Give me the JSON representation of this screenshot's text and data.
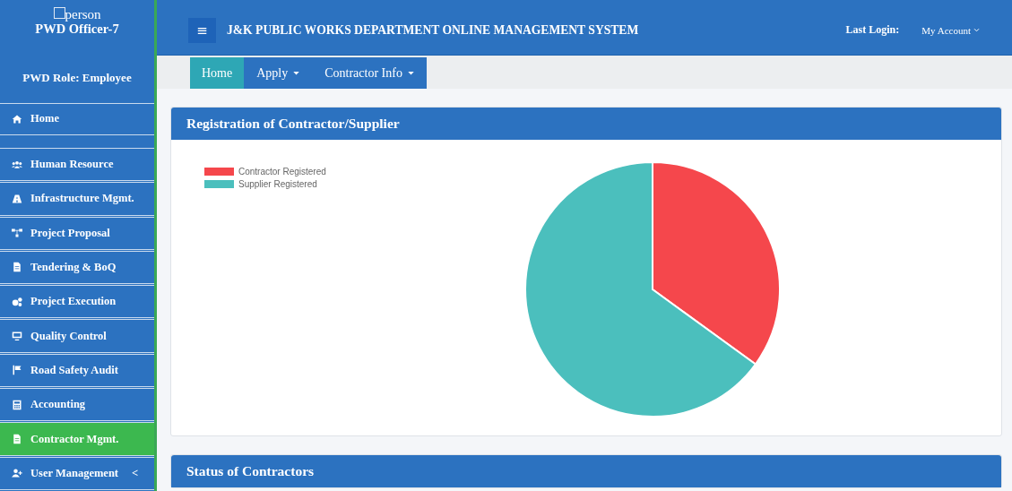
{
  "sidebar": {
    "user": {
      "icon_text": "person",
      "name": "PWD Officer-7"
    },
    "role": "PWD Role: Employee",
    "items": [
      {
        "label": "Home",
        "selected": false,
        "kind": "top"
      },
      {
        "label": "Human Resource",
        "selected": false,
        "kind": "item"
      },
      {
        "label": "Infrastructure Mgmt.",
        "selected": false,
        "kind": "item"
      },
      {
        "label": "Project Proposal",
        "selected": false,
        "kind": "item"
      },
      {
        "label": "Tendering & BoQ",
        "selected": false,
        "kind": "item"
      },
      {
        "label": "Project Execution",
        "selected": false,
        "kind": "item"
      },
      {
        "label": "Quality Control",
        "selected": false,
        "kind": "item"
      },
      {
        "label": "Road Safety Audit",
        "selected": false,
        "kind": "item"
      },
      {
        "label": "Accounting",
        "selected": false,
        "kind": "item"
      },
      {
        "label": "Contractor Mgmt.",
        "selected": true,
        "kind": "item"
      },
      {
        "label": "User Management",
        "selected": false,
        "kind": "item",
        "caret": "<"
      }
    ]
  },
  "header": {
    "menu_button": "≡",
    "title": "J&K PUBLIC WORKS DEPARTMENT ONLINE MANAGEMENT SYSTEM",
    "last_login": "Last Login:",
    "account": "My Account"
  },
  "tabs": [
    {
      "label": "Home",
      "selected": true,
      "dropdown": false
    },
    {
      "label": "Apply",
      "selected": false,
      "dropdown": true
    },
    {
      "label": "Contractor Info",
      "selected": false,
      "dropdown": true
    }
  ],
  "cards": [
    {
      "title": "Registration of Contractor/Supplier",
      "chart_data": {
        "type": "pie",
        "legend": "top-left",
        "categories": [
          "Contractor Registered",
          "Supplier Registered"
        ],
        "values": [
          35,
          65
        ],
        "colors": [
          "#f5474c",
          "#4bbfbd"
        ]
      }
    },
    {
      "title": "Status of Contractors"
    }
  ]
}
